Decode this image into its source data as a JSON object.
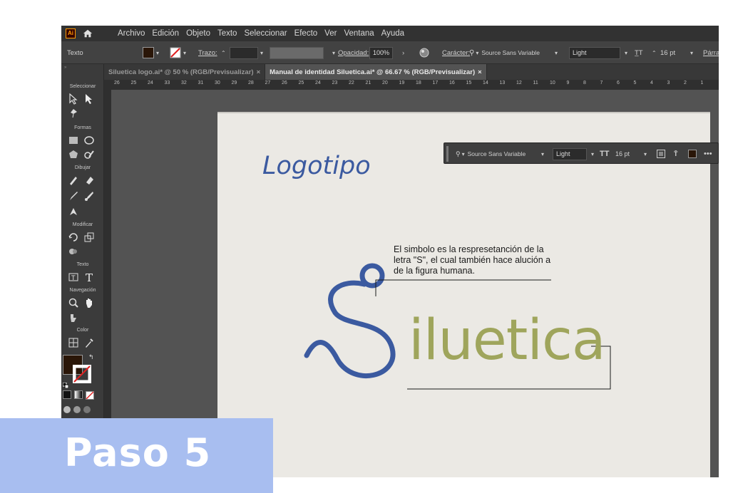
{
  "menu": {
    "items": [
      "Archivo",
      "Edición",
      "Objeto",
      "Texto",
      "Seleccionar",
      "Efecto",
      "Ver",
      "Ventana",
      "Ayuda"
    ]
  },
  "control": {
    "context": "Texto",
    "stroke_label": "Trazo:",
    "opacity_label": "Opacidad:",
    "opacity_value": "100%",
    "char_label": "Carácter:",
    "font": "Source Sans Variable",
    "weight": "Light",
    "size": "16 pt",
    "para_label": "Párra",
    "fill_color": "#2a1608"
  },
  "tabs": [
    {
      "label": "Silueti­ca logo.ai* @ 50 % (RGB/Previsualizar)",
      "close": "×"
    },
    {
      "label": "Manual de identidad Siluetica.ai* @ 66.67 % (RGB/Previsualizar)",
      "close": "×"
    }
  ],
  "ruler": {
    "ticks": [
      "26",
      "25",
      "24",
      "33",
      "32",
      "31",
      "30",
      "29",
      "28",
      "27",
      "26",
      "25",
      "24",
      "23",
      "22",
      "21",
      "20",
      "19",
      "18",
      "17",
      "16",
      "15",
      "14",
      "13",
      "12",
      "11",
      "10",
      "9",
      "8",
      "7",
      "6",
      "5",
      "4",
      "3",
      "2",
      "1"
    ]
  },
  "tools": {
    "groups": {
      "select": "Seleccionar",
      "shapes": "Formas",
      "draw": "Dibujar",
      "modify": "Modificar",
      "text": "Texto",
      "nav": "Navegación",
      "color": "Color"
    }
  },
  "artboard": {
    "title": "Logotipo",
    "annotation": "El simbolo es la respresetanción de la letra \"S\", el cual también hace alución a de la figura humana.",
    "wordmark": "iluetica",
    "symbol_color": "#3b5aa0",
    "wordmark_color": "#9fa55c"
  },
  "float_panel": {
    "font": "Source Sans Variable",
    "weight": "Light",
    "size": "16 pt"
  },
  "banner": {
    "text": "Paso 5",
    "color": "#a8bef0"
  }
}
